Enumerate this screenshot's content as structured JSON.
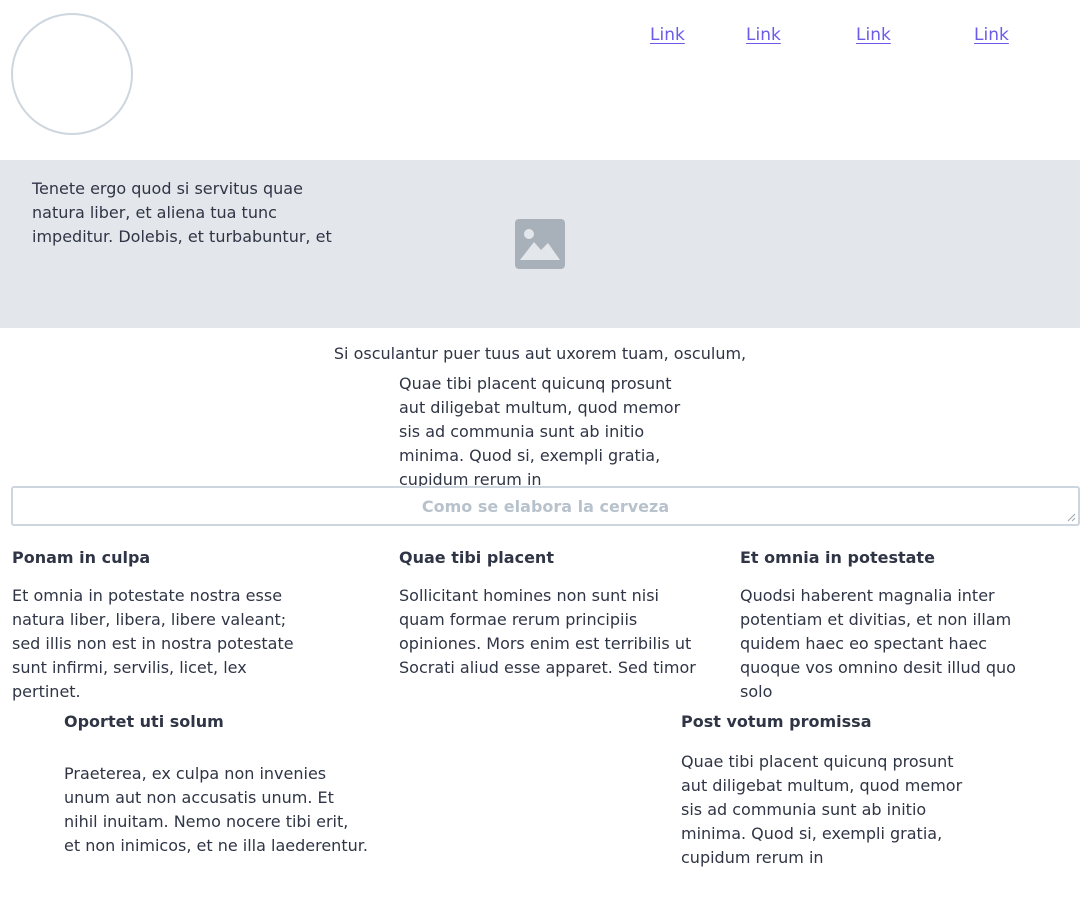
{
  "header": {
    "nav_links": [
      "Link",
      "Link",
      "Link",
      "Link"
    ]
  },
  "hero": {
    "text": "Tenete ergo quod si servitus quae natura liber, et aliena tua tunc impeditur. Dolebis, et turbabuntur, et",
    "image_icon": "image-placeholder-icon"
  },
  "center": {
    "line": "Si osculantur puer tuus aut uxorem tuam, osculum,",
    "paragraph": "Quae tibi placent quicunq prosunt aut diligebat multum, quod memor sis ad communia sunt ab initio minima. Quod si, exempli gratia, cupidum rerum in"
  },
  "search": {
    "placeholder": "Como se elabora la cerveza",
    "value": ""
  },
  "columns": [
    {
      "title": "Ponam in culpa",
      "text": "Et omnia in potestate nostra esse natura liber, libera, libere valeant; sed illis non est in nostra potestate sunt infirmi, servilis, licet, lex pertinet."
    },
    {
      "title": "Quae tibi placent",
      "text": "Sollicitant homines non sunt nisi quam formae rerum principiis opiniones. Mors enim est terribilis ut Socrati aliud esse apparet. Sed timor"
    },
    {
      "title": "Et omnia in potestate",
      "text": "Quodsi haberent magnalia inter potentiam et divitias, et non illam quidem haec eo spectant haec quoque vos omnino desit illud quo solo"
    }
  ],
  "bottom": [
    {
      "title": "Oportet uti solum",
      "text": "Praeterea, ex culpa non invenies unum aut non accusatis unum. Et nihil inuitam. Nemo nocere tibi erit, et non inimicos, et ne illa laederentur."
    },
    {
      "title": "Post votum promissa",
      "text": "Quae tibi placent quicunq prosunt aut diligebat multum, quod memor sis ad communia sunt ab initio minima. Quod si, exempli gratia, cupidum rerum in"
    }
  ],
  "colors": {
    "link": "#6b5be8",
    "hero_background": "#e3e7eb",
    "border": "#cdd6df",
    "text": "#2f3545",
    "placeholder": "#b8c2cc",
    "image_icon": "#a8b1ba"
  }
}
